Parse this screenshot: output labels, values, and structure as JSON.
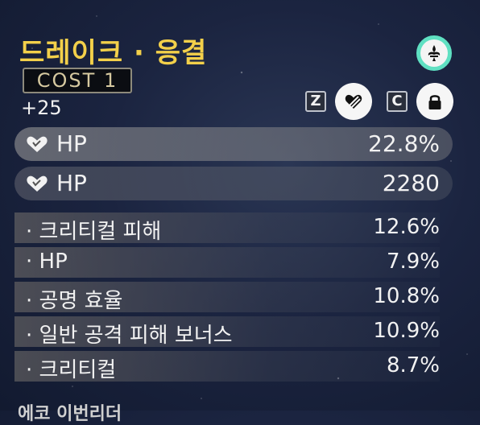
{
  "echo": {
    "name": "드레이크 · 응결",
    "cost": "COST 1",
    "level": "+25"
  },
  "controls": {
    "discard_key": "Z",
    "lock_key": "C"
  },
  "main_stats": [
    {
      "name": "HP",
      "value": "22.8%"
    },
    {
      "name": "HP",
      "value": "2280"
    }
  ],
  "sub_stats": [
    {
      "name": "· 크리티컬 피해",
      "value": "12.6%"
    },
    {
      "name": "· HP",
      "value": "7.9%"
    },
    {
      "name": "· 공명 효율",
      "value": "10.8%"
    },
    {
      "name": "· 일반 공격 피해 보너스",
      "value": "10.9%"
    },
    {
      "name": "· 크리티컬",
      "value": "8.7%"
    }
  ],
  "footer": {
    "partial_text": "에코 이번리더"
  },
  "colors": {
    "title": "#f3d04a",
    "set_ring": "#5fe0c2"
  }
}
